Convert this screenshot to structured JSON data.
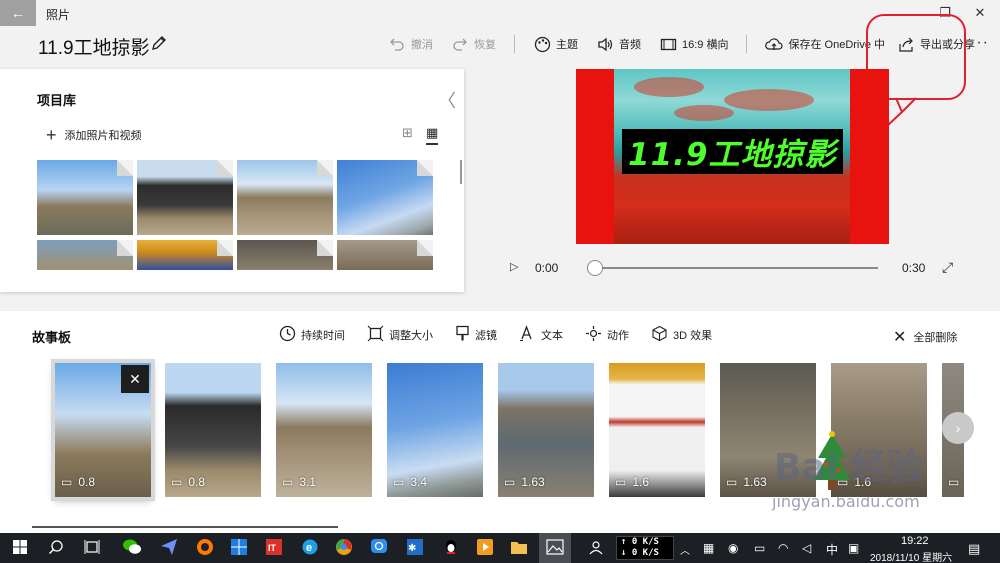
{
  "window": {
    "app_title": "照片",
    "back_glyph": "←",
    "minimize_glyph": "—",
    "restore_glyph": "❐",
    "close_glyph": "✕"
  },
  "project": {
    "title": "11.9工地掠影"
  },
  "toolbar": {
    "undo": "撤消",
    "redo": "恢复",
    "theme": "主题",
    "music": "音频",
    "aspect": "16:9 横向",
    "save_onedrive": "保存在 OneDrive 中",
    "export": "导出或分享",
    "more": "···"
  },
  "library": {
    "title": "项目库",
    "add": "添加照片和视频",
    "collapse_glyph": "〈"
  },
  "preview": {
    "caption": "11.9工地掠影",
    "current_time": "0:00",
    "end_time": "0:30",
    "play_glyph": "▷",
    "fullscreen_glyph": "⤢"
  },
  "storyboard": {
    "title": "故事板",
    "tools": {
      "duration": "持续时间",
      "resize": "调整大小",
      "filters": "滤镜",
      "text": "文本",
      "motion": "动作",
      "effects3d": "3D 效果"
    },
    "remove_all": "全部删除",
    "next_glyph": "›",
    "close_glyph": "✕",
    "clips": [
      {
        "duration": "0.8"
      },
      {
        "duration": "0.8"
      },
      {
        "duration": "3.1"
      },
      {
        "duration": "3.4"
      },
      {
        "duration": "1.63"
      },
      {
        "duration": "1.6"
      },
      {
        "duration": "1.63"
      },
      {
        "duration": "1.6"
      },
      {
        "duration": ""
      }
    ]
  },
  "watermark": {
    "brand": "Bai 经验",
    "url": "jingyan.baidu.com"
  },
  "taskbar": {
    "ime_lang": "中",
    "time": "19:22",
    "date": "2018/11/10 星期六",
    "net_up": "↑ 0 K/S",
    "net_down": "↓ 0 K/S",
    "notif_glyph": "▤"
  },
  "colors": {
    "accent_red": "#e0202e",
    "caption_green": "#4dff2b",
    "taskbar": "#1c1f23"
  }
}
